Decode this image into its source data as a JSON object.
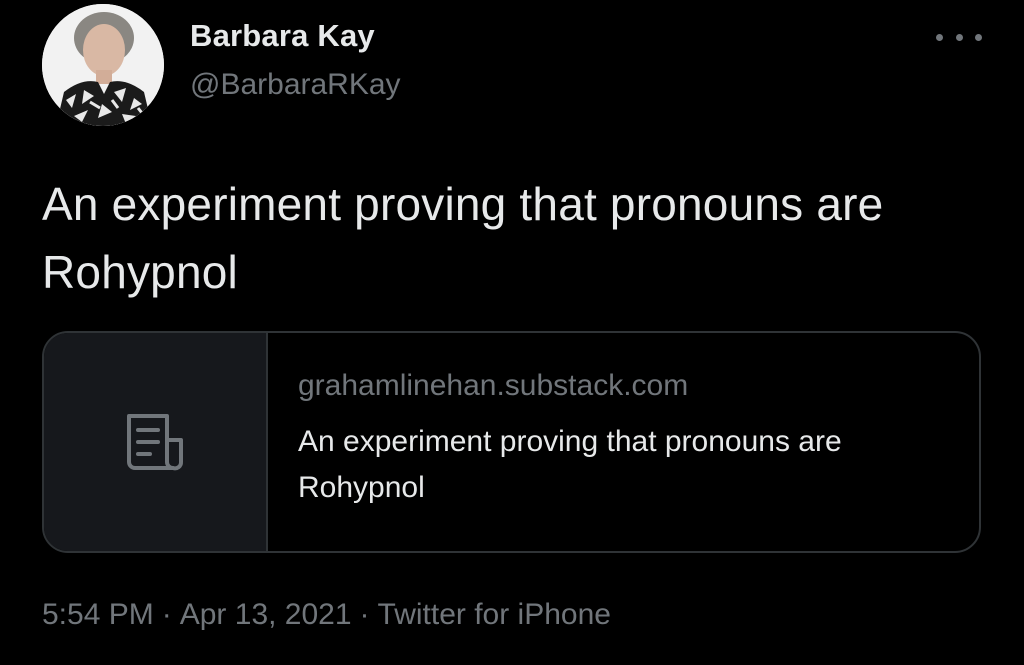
{
  "author": {
    "name": "Barbara Kay",
    "handle": "@BarbaraRKay"
  },
  "tweet": {
    "text": "An experiment proving that pronouns are Rohypnol"
  },
  "link_card": {
    "domain": "grahamlinehan.substack.com",
    "title": "An experiment proving that pronouns are Rohypnol",
    "icon": "article-icon"
  },
  "meta": {
    "time": "5:54 PM",
    "separator": "·",
    "date": "Apr 13, 2021",
    "source": "Twitter for iPhone"
  },
  "icons": {
    "more": "more-options-icon"
  },
  "colors": {
    "background": "#000000",
    "primary_text": "#e7e9ea",
    "secondary_text": "#71767b",
    "border": "#2f3336"
  }
}
